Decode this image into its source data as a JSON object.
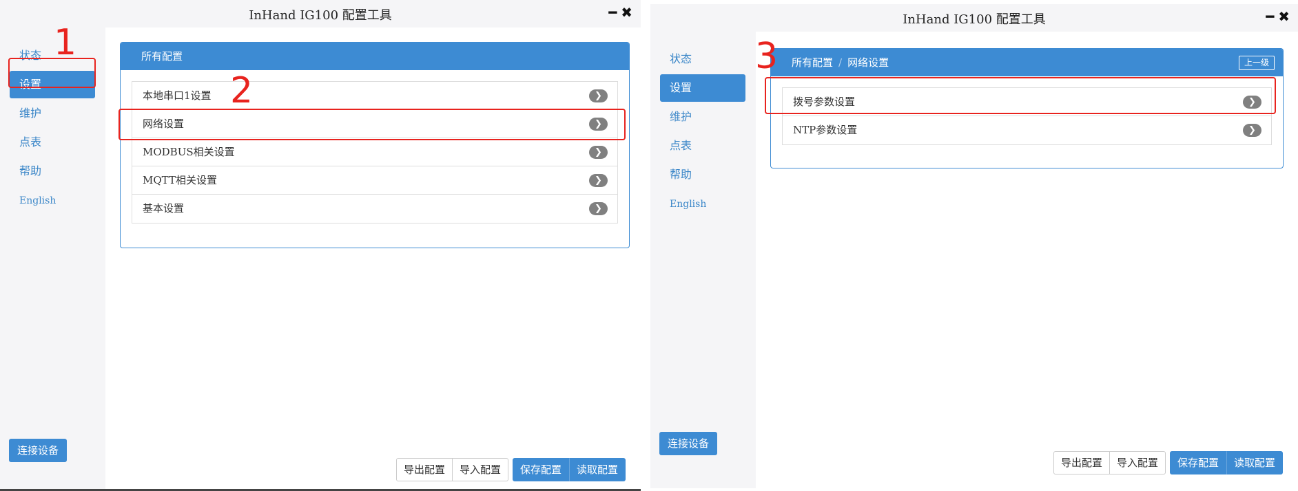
{
  "left": {
    "window_title": "InHand IG100 配置工具",
    "controls": {
      "minimize": "━",
      "close": "✖"
    },
    "nav": [
      "状态",
      "设置",
      "维护",
      "点表",
      "帮助",
      "English"
    ],
    "active_nav": "设置",
    "connect_button": "连接设备",
    "panel": {
      "header": "所有配置",
      "items": [
        "本地串口1设置",
        "网络设置",
        "MODBUS相关设置",
        "MQTT相关设置",
        "基本设置"
      ]
    },
    "buttons": {
      "export": "导出配置",
      "import": "导入配置",
      "save": "保存配置",
      "read": "读取配置"
    },
    "step_labels": [
      "1",
      "2"
    ]
  },
  "right": {
    "window_title": "InHand IG100 配置工具",
    "controls": {
      "minimize": "━",
      "close": "✖"
    },
    "nav": [
      "状态",
      "设置",
      "维护",
      "点表",
      "帮助",
      "English"
    ],
    "active_nav": "设置",
    "connect_button": "连接设备",
    "panel": {
      "breadcrumb_root": "所有配置",
      "breadcrumb_sep": "/",
      "breadcrumb_current": "网络设置",
      "up_button": "上一级",
      "items": [
        "拨号参数设置",
        "NTP参数设置"
      ]
    },
    "buttons": {
      "export": "导出配置",
      "import": "导入配置",
      "save": "保存配置",
      "read": "读取配置"
    },
    "step_labels": [
      "3"
    ]
  },
  "chevron_glyph": "❯",
  "colors": {
    "accent": "#3d8bd3",
    "highlight": "#e8231e",
    "sidebar_bg": "#f5f5f7"
  }
}
